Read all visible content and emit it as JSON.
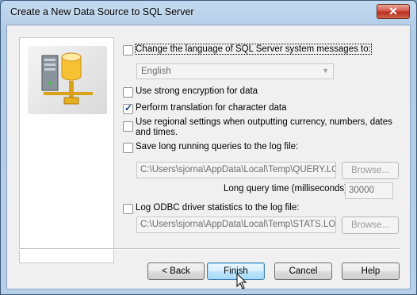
{
  "window": {
    "title": "Create a New Data Source to SQL Server",
    "close_glyph": "✕"
  },
  "options": {
    "change_language": {
      "label": "Change the language of SQL Server system messages to:",
      "checked": false
    },
    "language_select": {
      "value": "English"
    },
    "strong_encryption": {
      "label": "Use strong encryption for data",
      "checked": false
    },
    "perform_translation": {
      "label": "Perform translation for character data",
      "checked": true
    },
    "regional_settings": {
      "label": "Use regional settings when outputting currency, numbers, dates and times.",
      "checked": false
    },
    "save_long_queries": {
      "label": "Save long running queries to the log file:",
      "checked": false
    },
    "query_log_path": "C:\\Users\\sjorna\\AppData\\Local\\Temp\\QUERY.LO",
    "browse1_label": "Browse...",
    "long_query_time_label": "Long query time (milliseconds):",
    "long_query_time_value": "30000",
    "log_odbc_stats": {
      "label": "Log ODBC driver statistics to the log file:",
      "checked": false
    },
    "stats_log_path": "C:\\Users\\sjorna\\AppData\\Local\\Temp\\STATS.LOG",
    "browse2_label": "Browse..."
  },
  "buttons": {
    "back": "< Back",
    "finish": "Finish",
    "cancel": "Cancel",
    "help": "Help"
  },
  "icons": {
    "sidebar": "data-source-server-icon",
    "cursor": "mouse-pointer-icon"
  }
}
